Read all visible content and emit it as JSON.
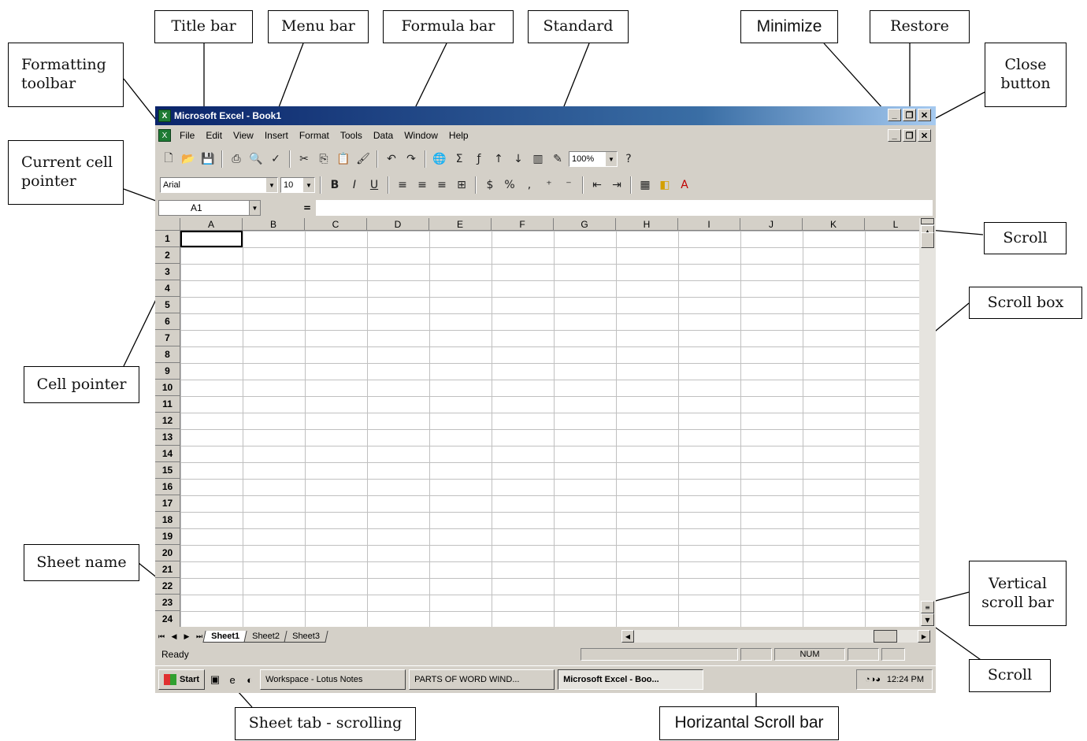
{
  "callouts": {
    "title_bar": "Title bar",
    "menu_bar": "Menu bar",
    "formula_bar": "Formula bar",
    "standard": "Standard",
    "minimize": "Minimize",
    "restore": "Restore",
    "close_button": "Close button",
    "formatting_toolbar": "Formatting toolbar",
    "current_cell_pointer": "Current cell pointer",
    "cell_pointer": "Cell pointer",
    "scroll_top": "Scroll",
    "scroll_box": "Scroll box",
    "vertical_scroll_bar": "Vertical scroll bar",
    "scroll_bottom": "Scroll",
    "sheet_name": "Sheet name",
    "sheet_tab_scrolling": "Sheet tab - scrolling",
    "horizontal_scroll_bar": "Horizantal Scroll bar"
  },
  "excel": {
    "title": "Microsoft Excel - Book1",
    "menu": [
      "File",
      "Edit",
      "View",
      "Insert",
      "Format",
      "Tools",
      "Data",
      "Window",
      "Help"
    ],
    "zoom": "100%",
    "font": "Arial",
    "font_size": "10",
    "name_box": "A1",
    "formula_eq": "=",
    "columns": [
      "A",
      "B",
      "C",
      "D",
      "E",
      "F",
      "G",
      "H",
      "I",
      "J",
      "K",
      "L"
    ],
    "rows": [
      "1",
      "2",
      "3",
      "4",
      "5",
      "6",
      "7",
      "8",
      "9",
      "10",
      "11",
      "12",
      "13",
      "14",
      "15",
      "16",
      "17",
      "18",
      "19",
      "20",
      "21",
      "22",
      "23",
      "24"
    ],
    "sheets": [
      "Sheet1",
      "Sheet2",
      "Sheet3"
    ],
    "status": "Ready",
    "num": "NUM",
    "taskbar": {
      "start": "Start",
      "tasks": [
        "Workspace - Lotus Notes",
        "PARTS OF WORD WIND...",
        "Microsoft Excel - Boo..."
      ],
      "clock": "12:24 PM"
    }
  }
}
